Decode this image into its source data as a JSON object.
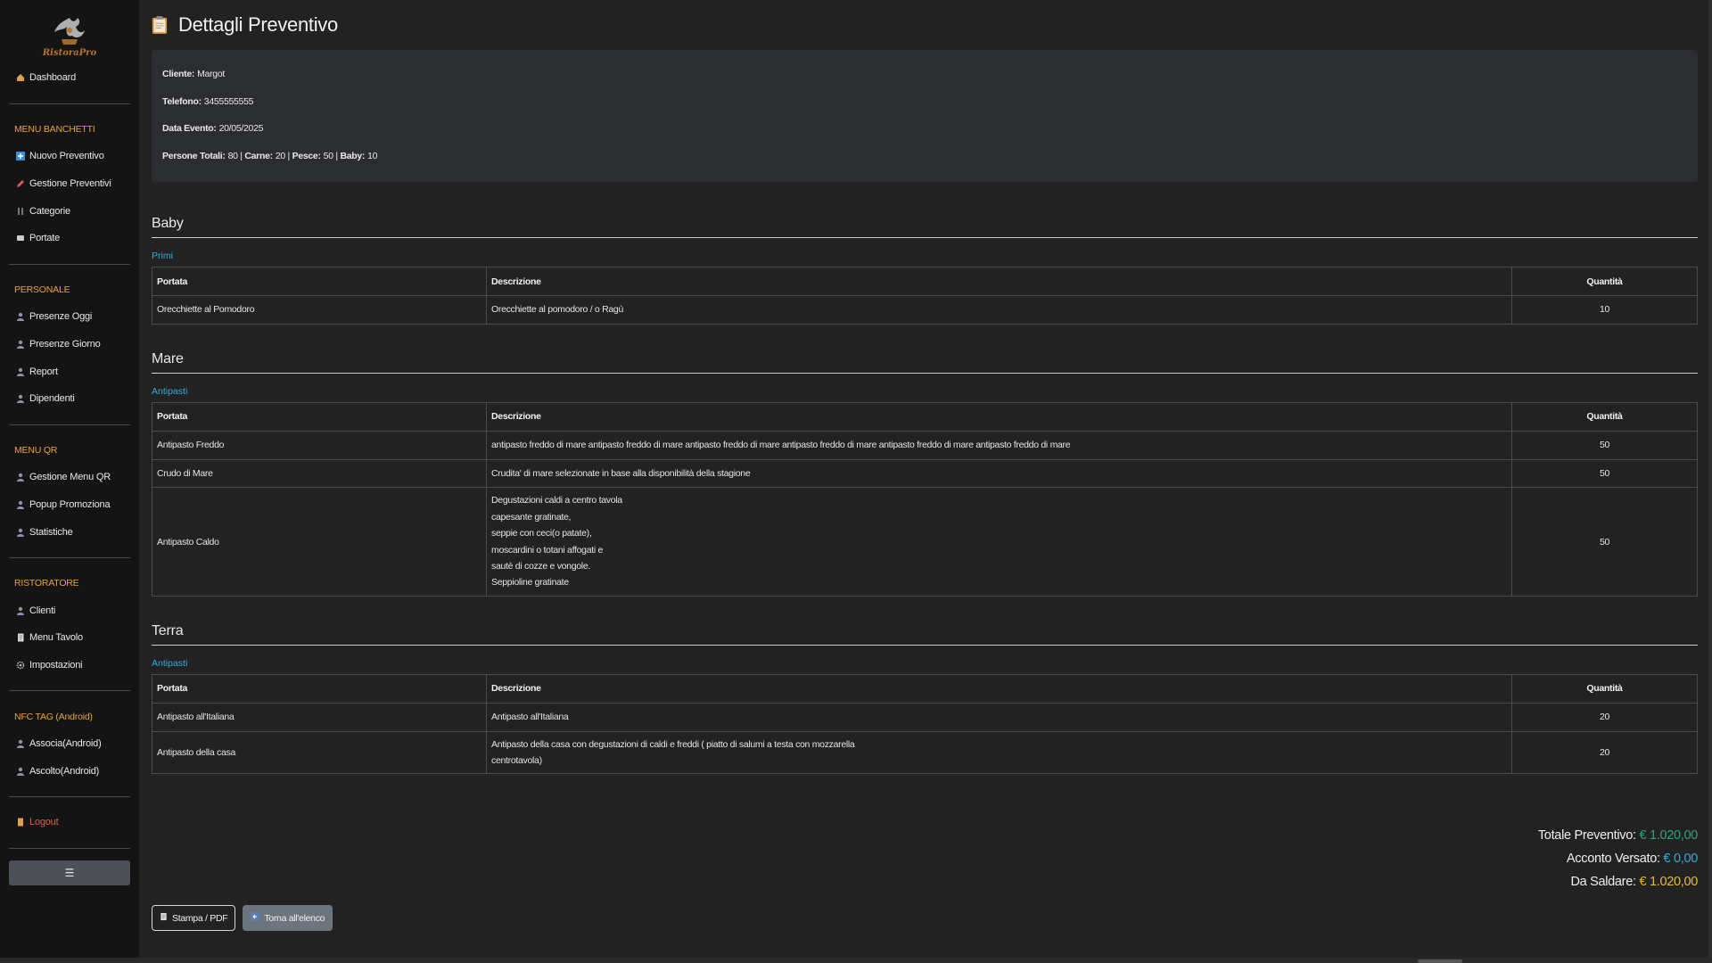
{
  "brand": {
    "name": "RistoraPro",
    "color": "#b8742a"
  },
  "colors": {
    "section": "#e9a23b",
    "category": "#3aa9dd",
    "total": "#2aa676",
    "deposit": "#3aa9dd",
    "balance": "#e9b93b",
    "logout": "#e25b4b"
  },
  "sidebar": {
    "dashboard": {
      "label": "Dashboard",
      "icon": "home-icon"
    },
    "sections": [
      {
        "title": "MENU BANCHETTI",
        "items": [
          {
            "label": "Nuovo Preventivo",
            "icon": "plus-square-icon"
          },
          {
            "label": "Gestione Preventivi",
            "icon": "pencil-icon"
          },
          {
            "label": "Categorie",
            "icon": "utensils-icon"
          },
          {
            "label": "Portate",
            "icon": "dish-icon"
          }
        ]
      },
      {
        "title": "PERSONALE",
        "items": [
          {
            "label": "Presenze Oggi",
            "icon": "user-icon"
          },
          {
            "label": "Presenze Giorno",
            "icon": "user-icon"
          },
          {
            "label": "Report",
            "icon": "user-icon"
          },
          {
            "label": "Dipendenti",
            "icon": "user-icon"
          }
        ]
      },
      {
        "title": "MENU QR",
        "items": [
          {
            "label": "Gestione Menu QR",
            "icon": "user-icon"
          },
          {
            "label": "Popup Promoziona",
            "icon": "user-icon"
          },
          {
            "label": "Statistiche",
            "icon": "user-icon"
          }
        ]
      },
      {
        "title": "RISTORATORE",
        "items": [
          {
            "label": "Clienti",
            "icon": "user-icon"
          },
          {
            "label": "Menu Tavolo",
            "icon": "document-icon"
          },
          {
            "label": "Impostazioni",
            "icon": "gear-icon"
          }
        ]
      },
      {
        "title": "NFC TAG (Android)",
        "items": [
          {
            "label": "Associa(Android)",
            "icon": "user-icon"
          },
          {
            "label": "Ascolto(Android)",
            "icon": "user-icon"
          }
        ]
      }
    ],
    "logout": {
      "label": "Logout",
      "icon": "door-icon"
    },
    "toggle": {
      "label": "☰",
      "icon": "hamburger-icon"
    }
  },
  "page": {
    "title": "Dettagli Preventivo",
    "icon": "clipboard-icon"
  },
  "info": {
    "cliente_label": "Cliente:",
    "cliente": "Margot",
    "telefono_label": "Telefono:",
    "telefono": "3455555555",
    "data_label": "Data Evento:",
    "data": "20/05/2025",
    "persone_label": "Persone Totali:",
    "persone": "80",
    "carne_label": "Carne:",
    "carne": "20",
    "pesce_label": "Pesce:",
    "pesce": "50",
    "baby_label": "Baby:",
    "baby": "10",
    "sep": "|"
  },
  "table_headers": {
    "portata": "Portata",
    "descrizione": "Descrizione",
    "quantita": "Quantità"
  },
  "groups": [
    {
      "title": "Baby",
      "category": "Primi",
      "rows": [
        {
          "portata": "Orecchiette al Pomodoro",
          "descrizione": [
            "Orecchiette al pomodoro / o Ragù"
          ],
          "quantita": "10"
        }
      ]
    },
    {
      "title": "Mare",
      "category": "Antipasti",
      "rows": [
        {
          "portata": "Antipasto Freddo",
          "descrizione": [
            "antipasto freddo di mare antipasto freddo di mare antipasto freddo di mare antipasto freddo di mare antipasto freddo di mare antipasto freddo di mare"
          ],
          "quantita": "50"
        },
        {
          "portata": "Crudo di Mare",
          "descrizione": [
            "Crudita' di mare selezionate in base alla disponibilità della stagione"
          ],
          "quantita": "50"
        },
        {
          "portata": "Antipasto Caldo",
          "descrizione": [
            "Degustazioni caldi a centro tavola",
            "capesante gratinate,",
            "seppie con ceci(o patate),",
            "moscardini o totani affogati e",
            "sautè di cozze e vongole.",
            "Seppioline gratinate"
          ],
          "quantita": "50"
        }
      ]
    },
    {
      "title": "Terra",
      "category": "Antipasti",
      "rows": [
        {
          "portata": "Antipasto all'Italiana",
          "descrizione": [
            "Antipasto all'Italiana"
          ],
          "quantita": "20"
        },
        {
          "portata": "Antipasto della casa",
          "descrizione": [
            "Antipasto della casa con degustazioni di caldi e freddi ( piatto di salumi a testa con mozzarella",
            "centrotavola)"
          ],
          "quantita": "20"
        }
      ]
    }
  ],
  "totals": {
    "totale_label": "Totale Preventivo:",
    "totale": "€ 1.020,00",
    "acconto_label": "Acconto Versato:",
    "acconto": "€ 0,00",
    "saldare_label": "Da Saldare:",
    "saldare": "€ 1.020,00"
  },
  "buttons": {
    "print": {
      "label": "Stampa / PDF",
      "icon": "document-icon"
    },
    "back": {
      "label": "Torna all'elenco",
      "icon": "arrow-left-icon"
    }
  }
}
